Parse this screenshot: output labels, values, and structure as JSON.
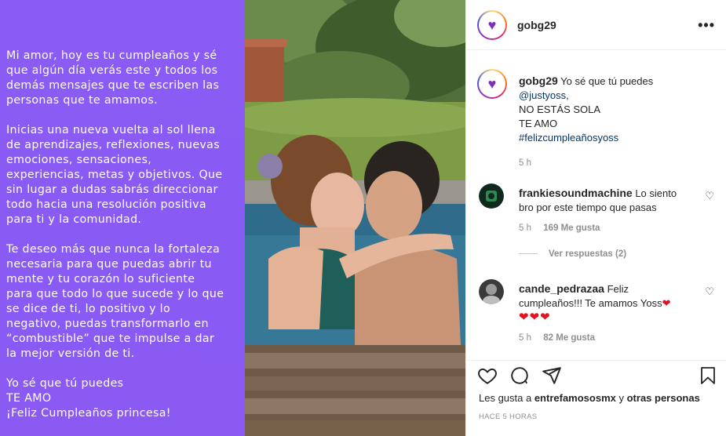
{
  "message": {
    "paragraphs": [
      "Mi amor, hoy es tu cumpleaños y sé\nque algún día verás este y todos los\ndemás mensajes que te escriben las\npersonas que te amamos.",
      "Inicias una nueva vuelta al sol llena\nde aprendizajes, reflexiones, nuevas\nemociones, sensaciones,\nexperiencias, metas y objetivos. Que\nsin lugar a dudas sabrás direccionar\ntodo hacia una resolución positiva\npara ti y la comunidad.",
      "Te deseo más que nunca la fortaleza\nnecesaria para que puedas abrir tu\nmente y tu corazón lo suficiente\npara que todo lo que sucede y lo que\nse dice de ti, lo positivo y lo\nnegativo, puedas transformarlo en\n“combustible” que te impulse a dar\nla mejor versión de ti.",
      "Yo sé que tú puedes\nTE AMO\n¡Feliz Cumpleaños princesa!"
    ],
    "background_color": "#8a5cf5"
  },
  "header": {
    "username": "gobg29",
    "avatar_icon": "purple-heart-icon",
    "more_icon": "more-options-icon",
    "more_glyph": "•••"
  },
  "caption": {
    "username": "gobg29",
    "text_line1": "Yo sé que tú puedes",
    "mention": "@justyoss",
    "mention_suffix": ",",
    "line3": "NO ESTÁS SOLA",
    "line4": "TE AMO",
    "hashtag": "#felizcumpleañosyoss",
    "time": "5 h"
  },
  "comments": [
    {
      "username": "frankiesoundmachine",
      "text": "Lo siento bro por este tiempo que pasas",
      "time": "5 h",
      "likes": "169 Me gusta",
      "replies": "Ver respuestas (2)"
    },
    {
      "username": "cande_pedrazaa",
      "text": "Feliz cumpleaños!!! Te amamos Yoss",
      "hearts_inline": "❤",
      "hearts_line": "❤❤❤",
      "time": "5 h",
      "likes": "82 Me gusta"
    }
  ],
  "actions": {
    "like_icon": "heart-outline-icon",
    "comment_icon": "comment-icon",
    "share_icon": "send-icon",
    "save_icon": "bookmark-icon",
    "likes_prefix": "Les gusta a ",
    "likes_user": "entrefamososmx",
    "likes_and": " y ",
    "likes_others": "otras personas",
    "timestamp": "HACE 5 HORAS"
  },
  "colors": {
    "accent_link": "#00376b",
    "muted": "#8e8e8e",
    "heart_red": "#e0131f"
  }
}
